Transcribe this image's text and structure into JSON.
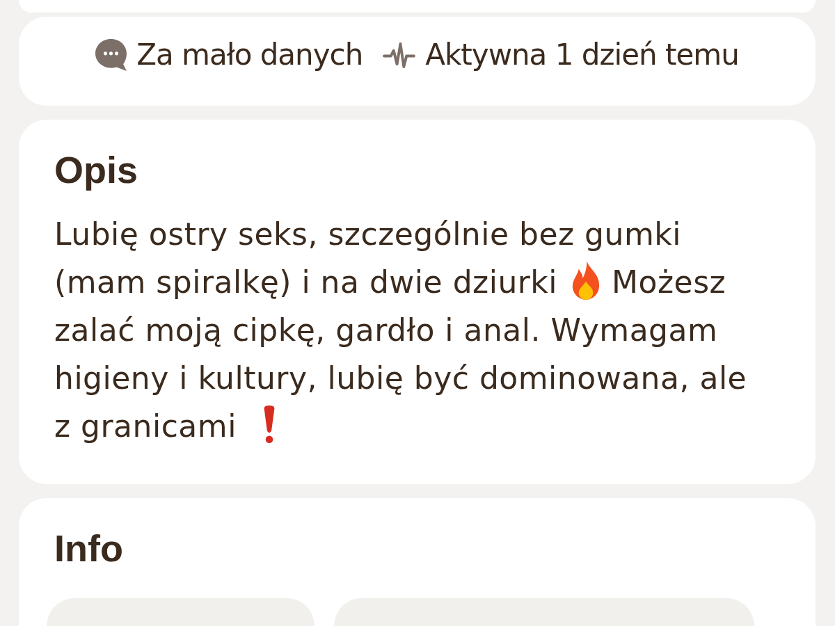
{
  "status": [
    {
      "kind": "messages",
      "text": "Za mało danych"
    },
    {
      "kind": "activity",
      "text": "Aktywna 1 dzień temu"
    }
  ],
  "description": {
    "title": "Opis",
    "lines": [
      {
        "parts": [
          {
            "kind": "text",
            "text": "Lubię ostry seks, szczególnie bez gumki"
          }
        ]
      },
      {
        "parts": [
          {
            "kind": "text",
            "text": "(mam spiralkę) i na dwie dziurki"
          },
          {
            "kind": "fire"
          },
          {
            "kind": "text",
            "text": "Możesz"
          }
        ]
      },
      {
        "parts": [
          {
            "kind": "text",
            "text": "zalać moją cipkę, gardło i anal. Wymagam"
          }
        ]
      },
      {
        "parts": [
          {
            "kind": "text",
            "text": "higieny i kultury, lubię być dominowana, ale"
          }
        ]
      },
      {
        "parts": [
          {
            "kind": "text",
            "text": "z granicami"
          },
          {
            "kind": "exclamation"
          }
        ]
      }
    ]
  },
  "info": {
    "title": "Info",
    "chips": [
      {
        "kind": "pill"
      },
      {
        "kind": "pill"
      }
    ]
  }
}
